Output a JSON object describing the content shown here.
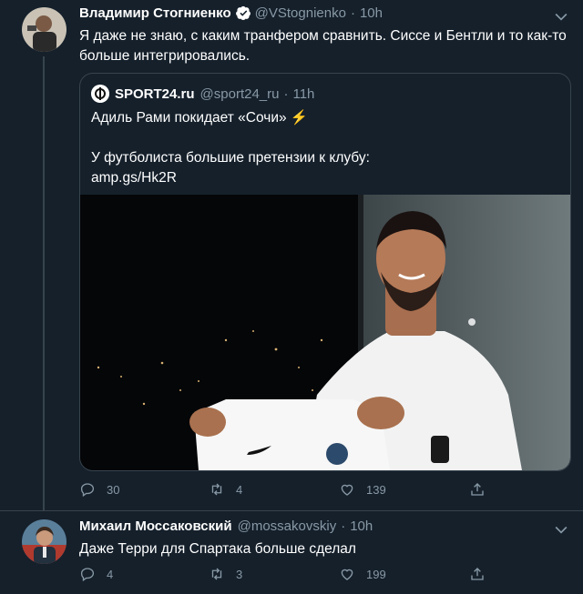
{
  "tweet1": {
    "name": "Владимир Стогниенко",
    "handle": "@VStognienko",
    "dot": "·",
    "time": "10h",
    "text": "Я даже не знаю, с каким транфером сравнить. Сиссе и Бентли и то как-то больше интегрировались.",
    "quote": {
      "name": "SPORT24.ru",
      "handle": "@sport24_ru",
      "dot": "·",
      "time": "11h",
      "line1": "Адиль Рами покидает «Сочи» ⚡",
      "line2": "У футболиста большие претензии к клубу:",
      "link": "amp.gs/Hk2R"
    },
    "actions": {
      "replies": "30",
      "retweets": "4",
      "likes": "139"
    }
  },
  "tweet2": {
    "name": "Михаил Моссаковский",
    "handle": "@mossakovskiy",
    "dot": "·",
    "time": "10h",
    "text": "Даже Терри для Спартака больше сделал",
    "actions": {
      "replies": "4",
      "retweets": "3",
      "likes": "199"
    }
  },
  "icons": {
    "reply": "reply-icon",
    "retweet": "retweet-icon",
    "like": "heart-icon",
    "share": "share-icon",
    "more": "chevron-down-icon",
    "verified": "verified-badge-icon"
  },
  "colors": {
    "background": "#15202b",
    "border": "#38444d",
    "muted": "#8899a6",
    "verified": "#ffffff"
  }
}
